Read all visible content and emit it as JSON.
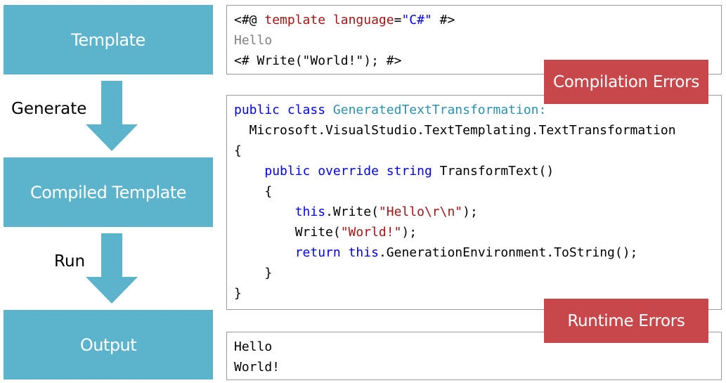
{
  "colors": {
    "stage_fill": "#5bb3cc",
    "error_fill": "#c8474a",
    "keyword": "#0000ff",
    "type_name": "#2b91af",
    "string": "#a31515",
    "directive": "#a31515",
    "plain_text": "#808080",
    "code": "#000000"
  },
  "stages": {
    "template": "Template",
    "compiled": "Compiled Template",
    "output": "Output"
  },
  "steps": {
    "generate": "Generate",
    "run": "Run"
  },
  "errors": {
    "compilation": "Compilation Errors",
    "runtime": "Runtime Errors"
  },
  "template_code": [
    [
      {
        "t": "<#@ ",
        "c": "code"
      },
      {
        "t": "template",
        "c": "directive"
      },
      {
        "t": " ",
        "c": "code"
      },
      {
        "t": "language",
        "c": "directive"
      },
      {
        "t": "=",
        "c": "code"
      },
      {
        "t": "\"C#\"",
        "c": "keyword"
      },
      {
        "t": " #>",
        "c": "code"
      }
    ],
    [
      {
        "t": "Hello",
        "c": "plain_text"
      }
    ],
    [
      {
        "t": "<# Write(\"World!\"); #>",
        "c": "code"
      }
    ]
  ],
  "compiled_code": [
    [
      {
        "t": "public",
        "c": "keyword"
      },
      {
        "t": " ",
        "c": "code"
      },
      {
        "t": "class",
        "c": "keyword"
      },
      {
        "t": " ",
        "c": "code"
      },
      {
        "t": "GeneratedTextTransformation:",
        "c": "type_name"
      }
    ],
    [
      {
        "t": "  Microsoft.VisualStudio.TextTemplating.TextTransformation",
        "c": "code"
      }
    ],
    [
      {
        "t": "{",
        "c": "code"
      }
    ],
    [
      {
        "t": "    ",
        "c": "code"
      },
      {
        "t": "public",
        "c": "keyword"
      },
      {
        "t": " ",
        "c": "code"
      },
      {
        "t": "override",
        "c": "keyword"
      },
      {
        "t": " ",
        "c": "code"
      },
      {
        "t": "string",
        "c": "keyword"
      },
      {
        "t": " TransformText()",
        "c": "code"
      }
    ],
    [
      {
        "t": "    {",
        "c": "code"
      }
    ],
    [
      {
        "t": "        ",
        "c": "code"
      },
      {
        "t": "this",
        "c": "keyword"
      },
      {
        "t": ".Write(",
        "c": "code"
      },
      {
        "t": "\"Hello\\r\\n\"",
        "c": "string"
      },
      {
        "t": ");",
        "c": "code"
      }
    ],
    [
      {
        "t": "        Write(",
        "c": "code"
      },
      {
        "t": "\"World!\"",
        "c": "string"
      },
      {
        "t": ");",
        "c": "code"
      }
    ],
    [
      {
        "t": "        ",
        "c": "code"
      },
      {
        "t": "return",
        "c": "keyword"
      },
      {
        "t": " ",
        "c": "code"
      },
      {
        "t": "this",
        "c": "keyword"
      },
      {
        "t": ".GenerationEnvironment.ToString();",
        "c": "code"
      }
    ],
    [
      {
        "t": "    }",
        "c": "code"
      }
    ],
    [
      {
        "t": "}",
        "c": "code"
      }
    ]
  ],
  "output_text": [
    [
      {
        "t": "Hello",
        "c": "code"
      }
    ],
    [
      {
        "t": "World!",
        "c": "code"
      }
    ]
  ]
}
